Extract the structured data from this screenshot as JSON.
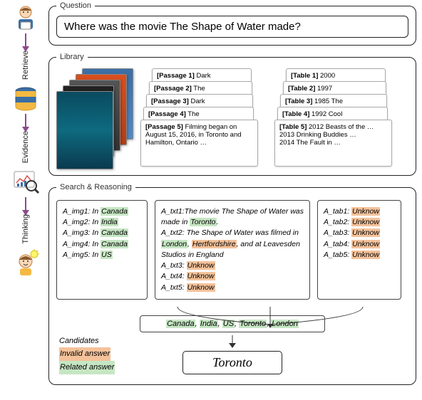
{
  "stages": {
    "retrieve": "Retrieve",
    "evidence": "Evidence",
    "thinking": "Thinking"
  },
  "question": {
    "legend": "Question",
    "text": "Where was the movie The Shape of Water made?"
  },
  "library": {
    "legend": "Library",
    "passages": [
      {
        "label": "[Passage 1]",
        "snippet": "Dark"
      },
      {
        "label": "[Passage 2]",
        "snippet": "The"
      },
      {
        "label": "[Passage 3]",
        "snippet": "Dark"
      },
      {
        "label": "[Passage 4]",
        "snippet": "The"
      },
      {
        "label": "[Passage 5]",
        "snippet": "Filming began on August 15, 2016, in Toronto and Hamilton, Ontario …"
      }
    ],
    "tables": [
      {
        "label": "[Table 1]",
        "snippet": "2000"
      },
      {
        "label": "[Table 2]",
        "snippet": "1997"
      },
      {
        "label": "[Table 3]",
        "snippet": "1985 The"
      },
      {
        "label": "[Table 4]",
        "snippet": "1992 Cool"
      },
      {
        "label": "[Table 5]",
        "snippet": "2012 Beasts of the …\n2013 Drinking Buddies …\n2014 The Fault in …"
      }
    ]
  },
  "search_reasoning": {
    "legend": "Search & Reasoning",
    "img_answers": [
      {
        "prefix": "A_img1: In ",
        "val": "Canada",
        "type": "green"
      },
      {
        "prefix": "A_img2: In ",
        "val": "India",
        "type": "green"
      },
      {
        "prefix": "A_img3: In ",
        "val": "Canada",
        "type": "green"
      },
      {
        "prefix": "A_img4: In ",
        "val": "Canada",
        "type": "green"
      },
      {
        "prefix": "A_img5: In ",
        "val": "US",
        "type": "green"
      }
    ],
    "txt_block": {
      "line1_pre": "A_txt1:The movie The Shape of Water was made in ",
      "line1_hl": "Toronto",
      "line1_post": ".",
      "line2_pre": "A_txt2: The Shape of Water was filmed in ",
      "line2_hl1": "London",
      "line2_mid1": ", ",
      "line2_hl2": "Hertfordshire",
      "line2_mid2": ", and at Leavesden Studios in England",
      "lines_unknown": [
        {
          "prefix": "A_txt3: ",
          "val": "Unknow"
        },
        {
          "prefix": "A_txt4: ",
          "val": "Unknow"
        },
        {
          "prefix": "A_txt5: ",
          "val": "Unknow"
        }
      ]
    },
    "tab_answers": [
      {
        "prefix": "A_tab1: ",
        "val": "Unknow"
      },
      {
        "prefix": "A_tab2: ",
        "val": "Unknow"
      },
      {
        "prefix": "A_tab3: ",
        "val": "Unknow"
      },
      {
        "prefix": "A_tab4: ",
        "val": "Unknow"
      },
      {
        "prefix": "A_tab5: ",
        "val": "Unknow"
      }
    ],
    "candidates": {
      "items": [
        "Canada",
        "India",
        "US",
        "Toronto",
        "London"
      ],
      "sep": ", "
    },
    "final": "Toronto",
    "legend_labels": {
      "candidates": "Candidates",
      "invalid": "Invalid answer",
      "related": "Related answer"
    }
  }
}
